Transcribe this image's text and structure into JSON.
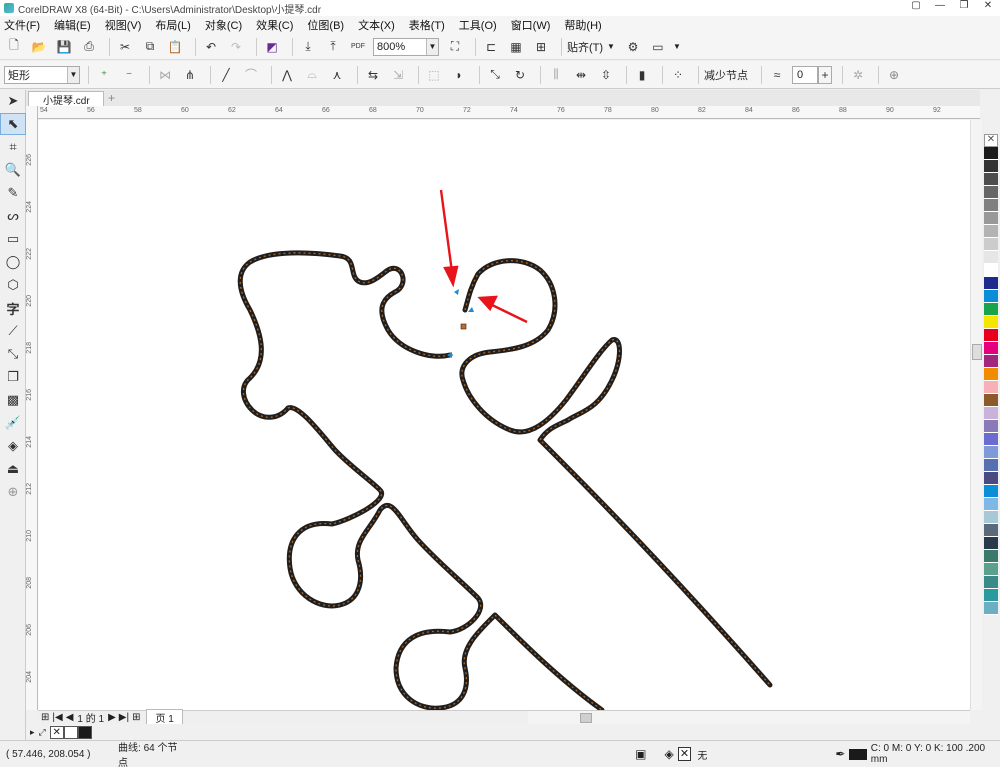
{
  "window": {
    "title": "CorelDRAW X8 (64-Bit) - C:\\Users\\Administrator\\Desktop\\小提琴.cdr"
  },
  "menu": [
    "文件(F)",
    "编辑(E)",
    "视图(V)",
    "布局(L)",
    "对象(C)",
    "效果(C)",
    "位图(B)",
    "文本(X)",
    "表格(T)",
    "工具(O)",
    "窗口(W)",
    "帮助(H)"
  ],
  "toolbar": {
    "zoom": "800%",
    "snap": "贴齐(T)",
    "pdf": "PDF"
  },
  "propertybar": {
    "shape_type": "矩形",
    "reduce_nodes": "减少节点",
    "smoothness": "0"
  },
  "document": {
    "tab": "小提琴.cdr"
  },
  "ruler": {
    "h": [
      "54",
      "56",
      "58",
      "60",
      "62",
      "64",
      "66",
      "68",
      "70",
      "72",
      "74",
      "76",
      "78",
      "80",
      "82",
      "84",
      "86",
      "88",
      "90",
      "92"
    ],
    "v": [
      "226",
      "224",
      "222",
      "220",
      "218",
      "216",
      "214",
      "212",
      "210",
      "208",
      "206",
      "204"
    ]
  },
  "pagenav": {
    "page_of": "1 的 1",
    "page_tab": "页 1"
  },
  "status": {
    "coords": "( 57.446, 208.054 )",
    "object_info": "曲线: 64 个节点",
    "fill": "无",
    "outline": "C: 0 M: 0 Y: 0 K: 100  .200 mm"
  },
  "palette": [
    "#1a1a1a",
    "#333333",
    "#4d4d4d",
    "#666666",
    "#808080",
    "#999999",
    "#b3b3b3",
    "#cccccc",
    "#e6e6e6",
    "#ffffff",
    "#1e2a8c",
    "#0a8fd6",
    "#1aa34a",
    "#f5e500",
    "#e6001e",
    "#e4007f",
    "#a0267e",
    "#f08c00",
    "#f7b0b8",
    "#8b5a2b",
    "#c9b3d9",
    "#8a7bb8",
    "#6b6bd0",
    "#7f9ad8",
    "#5670b0",
    "#4a4a80",
    "#0a8fd6",
    "#7fb8e6",
    "#a8c8d8",
    "#5a6a7a",
    "#2a3a4a",
    "#3a7a6a",
    "#5aa08a",
    "#3a8a8a",
    "#2a9aa0",
    "#6ab0c0"
  ]
}
